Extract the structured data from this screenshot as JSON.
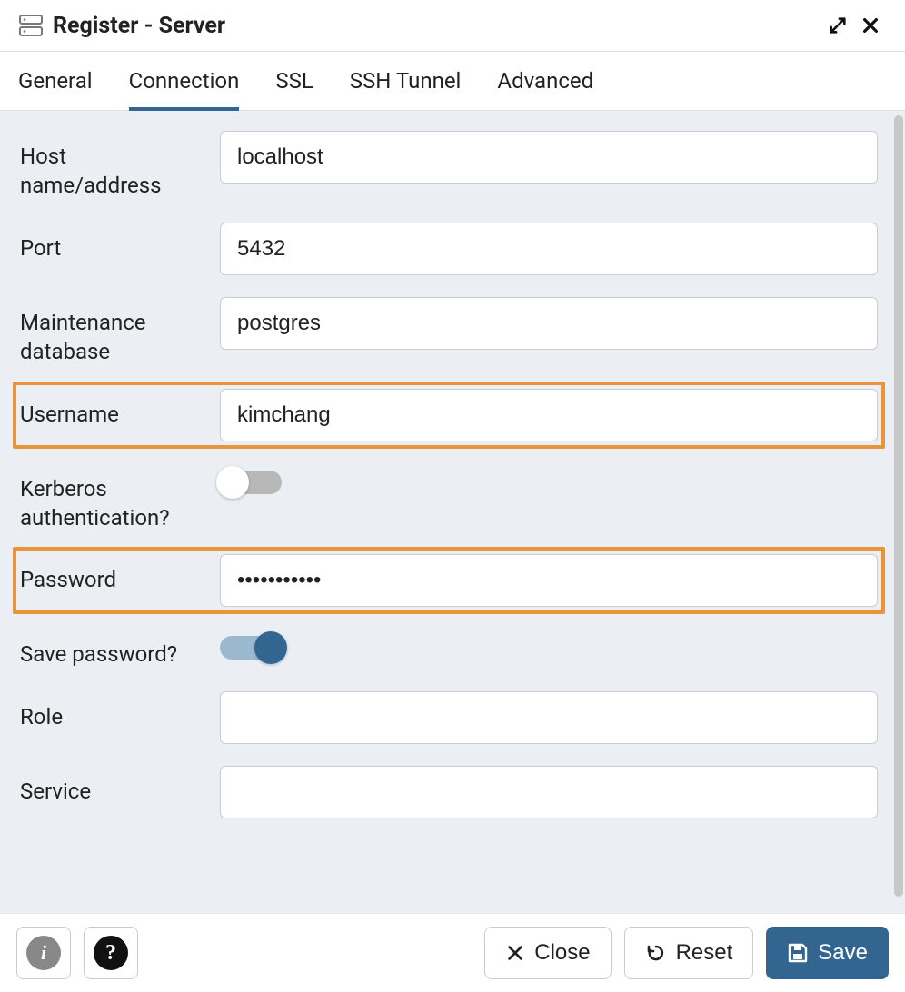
{
  "header": {
    "title": "Register - Server"
  },
  "tabs": [
    {
      "label": "General",
      "active": false
    },
    {
      "label": "Connection",
      "active": true
    },
    {
      "label": "SSL",
      "active": false
    },
    {
      "label": "SSH Tunnel",
      "active": false
    },
    {
      "label": "Advanced",
      "active": false
    }
  ],
  "form": {
    "host": {
      "label": "Host name/address",
      "value": "localhost"
    },
    "port": {
      "label": "Port",
      "value": "5432"
    },
    "maintenance_db": {
      "label": "Maintenance database",
      "value": "postgres"
    },
    "username": {
      "label": "Username",
      "value": "kimchang",
      "highlighted": true
    },
    "kerberos": {
      "label": "Kerberos authentication?",
      "on": false
    },
    "password": {
      "label": "Password",
      "value": "•••••••••••",
      "highlighted": true
    },
    "save_password": {
      "label": "Save password?",
      "on": true
    },
    "role": {
      "label": "Role",
      "value": ""
    },
    "service": {
      "label": "Service",
      "value": ""
    }
  },
  "footer": {
    "close_label": "Close",
    "reset_label": "Reset",
    "save_label": "Save"
  }
}
